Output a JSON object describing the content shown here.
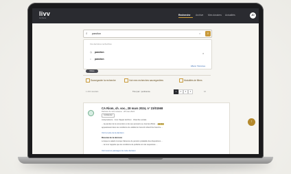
{
  "app": {
    "logo": "livv",
    "logo_sub": "lexbase"
  },
  "nav": {
    "items": [
      "Recherche",
      "Archive",
      "Mes dossiers",
      "Actualités"
    ],
    "active_index": 0,
    "avatar_initials": "JD"
  },
  "search": {
    "value": "parution",
    "placeholder": "Rechercher..."
  },
  "dropdown": {
    "title": "Vos dernières recherches",
    "rows": [
      {
        "label": "parution",
        "icon": "history-icon"
      },
      {
        "label": "parution",
        "icon": "search-icon"
      }
    ],
    "delete_label": "Effacer l'historique"
  },
  "filters": {
    "pill_label": "Filtres"
  },
  "tools": [
    {
      "label": "Sauvegarder la recherche"
    },
    {
      "label": "Voir mes recherches sauvegardées"
    },
    {
      "label": "Modalités de filtres"
    }
  ],
  "results": {
    "count_label": "1 234 résultats",
    "sort_label": "Trier par : pertinence",
    "pages": [
      "1",
      "2",
      "3",
      "4"
    ],
    "per_page": "10"
  },
  "card": {
    "title": "CA Riom, ch. soc., 28 mars 2024, n° 23/01568",
    "subtitle": "Décision de 1ère instance · 28 mars 2024",
    "badge": "Confidentiel",
    "l1": "Jurisprudence · Cour d'appel de Riom · Chambre sociale",
    "l2a": "... la parution de la convention et de ses avenants au Journal officiel ...",
    "l2b": "parution",
    "l3": "apparaissant dans les conditions de validité de l'accord collectif de branche ...",
    "link1": "Voir le texte de la décision",
    "sect": "Résumé de la décision",
    "l4": "Lorsque le salarié invoque l'absence de parution préalable des dispositions ...",
    "l5": "... la Cour rappelle que les conditions de publicité ont été respectées ...",
    "link2": "Voir tous les passages de cette décision",
    "fab": "↑"
  }
}
